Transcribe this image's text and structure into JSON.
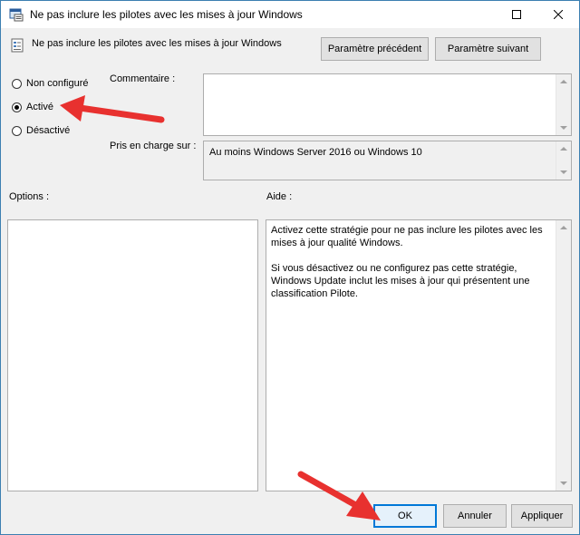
{
  "window": {
    "title": "Ne pas inclure les pilotes avec les mises à jour Windows"
  },
  "header": {
    "policy_name": "Ne pas inclure les pilotes avec les mises à jour Windows",
    "prev_button": "Paramètre précédent",
    "next_button": "Paramètre suivant"
  },
  "state": {
    "options": [
      {
        "label": "Non configuré",
        "checked": false
      },
      {
        "label": "Activé",
        "checked": true
      },
      {
        "label": "Désactivé",
        "checked": false
      }
    ]
  },
  "comment": {
    "label": "Commentaire :",
    "value": ""
  },
  "supported": {
    "label": "Pris en charge sur :",
    "value": "Au moins Windows Server 2016 ou Windows 10"
  },
  "options_panel": {
    "label": "Options :"
  },
  "help_panel": {
    "label": "Aide :",
    "paragraphs": [
      "Activez cette stratégie pour ne pas inclure les pilotes avec les mises à jour qualité Windows.",
      "Si vous désactivez ou ne configurez pas cette stratégie, Windows Update inclut les mises à jour qui présentent une classification Pilote."
    ]
  },
  "footer": {
    "ok": "OK",
    "cancel": "Annuler",
    "apply": "Appliquer"
  },
  "colors": {
    "annotation_arrow": "#e8312f",
    "accent": "#0078d7"
  }
}
